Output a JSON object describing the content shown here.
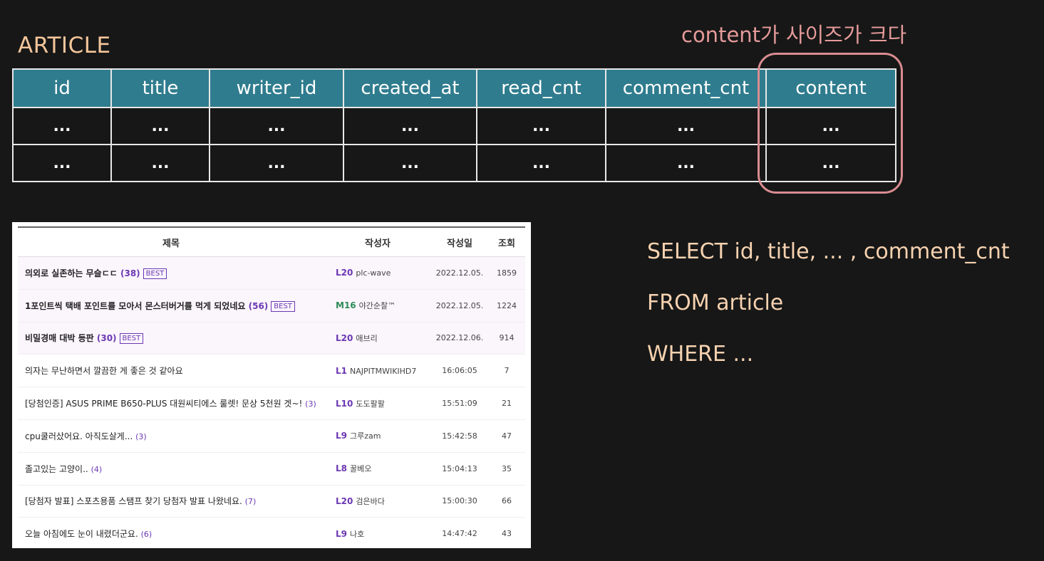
{
  "table_name": "ARTICLE",
  "annotation": "content가 사이즈가 크다",
  "columns": [
    "id",
    "title",
    "writer_id",
    "created_at",
    "read_cnt",
    "comment_cnt",
    "content"
  ],
  "rows": [
    [
      "...",
      "...",
      "...",
      "...",
      "...",
      "...",
      "..."
    ],
    [
      "...",
      "...",
      "...",
      "...",
      "...",
      "...",
      "..."
    ]
  ],
  "board": {
    "headers": {
      "title": "제목",
      "writer": "작성자",
      "date": "작성일",
      "views": "조회"
    },
    "best_label": "BEST",
    "posts": [
      {
        "title": "의외로 실존하는 무슬ㄷㄷ",
        "count": "(38)",
        "best": true,
        "level": "L20",
        "writer": "plc-wave",
        "date": "2022.12.05.",
        "views": "1859"
      },
      {
        "title": "1포인트씩 택배 포인트를 모아서 몬스터버거를 먹게 되었네요",
        "count": "(56)",
        "best": true,
        "level": "M16",
        "writer": "야간순찰™",
        "date": "2022.12.05.",
        "views": "1224"
      },
      {
        "title": "비밀경매 대박 등판",
        "count": "(30)",
        "best": true,
        "level": "L20",
        "writer": "애브리",
        "date": "2022.12.06.",
        "views": "914"
      },
      {
        "title": "의자는 무난하면서 깔끔한 게 좋은 것 같아요",
        "count": "",
        "best": false,
        "level": "L1",
        "writer": "NAJPITMWIKIHD7",
        "date": "16:06:05",
        "views": "7"
      },
      {
        "title": "[당첨인증] ASUS PRIME B650-PLUS 대원씨티에스 룰렛! 문상 5천원 겟~!",
        "count": "(3)",
        "best": false,
        "level": "L10",
        "writer": "도도팔팔",
        "date": "15:51:09",
        "views": "21"
      },
      {
        "title": "cpu쿨러샀어요. 아직도살게...",
        "count": "(3)",
        "best": false,
        "level": "L9",
        "writer": "그루zam",
        "date": "15:42:58",
        "views": "47"
      },
      {
        "title": "졸고있는 고양이..",
        "count": "(4)",
        "best": false,
        "level": "L8",
        "writer": "꿀베오",
        "date": "15:04:13",
        "views": "35"
      },
      {
        "title": "[당첨자 발표] 스포츠용품 스탬프 찾기 당첨자 발표 나왔네요.",
        "count": "(7)",
        "best": false,
        "level": "L20",
        "writer": "검은바다",
        "date": "15:00:30",
        "views": "66"
      },
      {
        "title": "오늘 아침에도 눈이 내렸더군요.",
        "count": "(6)",
        "best": false,
        "level": "L9",
        "writer": "나호",
        "date": "14:47:42",
        "views": "43"
      }
    ]
  },
  "sql": [
    "SELECT id, title, ... , comment_cnt",
    "FROM article",
    "WHERE ..."
  ],
  "colors": {
    "accent": "#2f7c8e",
    "annotation": "#e59a9a",
    "label": "#f4c59a",
    "sql": "#f6d2b0"
  }
}
